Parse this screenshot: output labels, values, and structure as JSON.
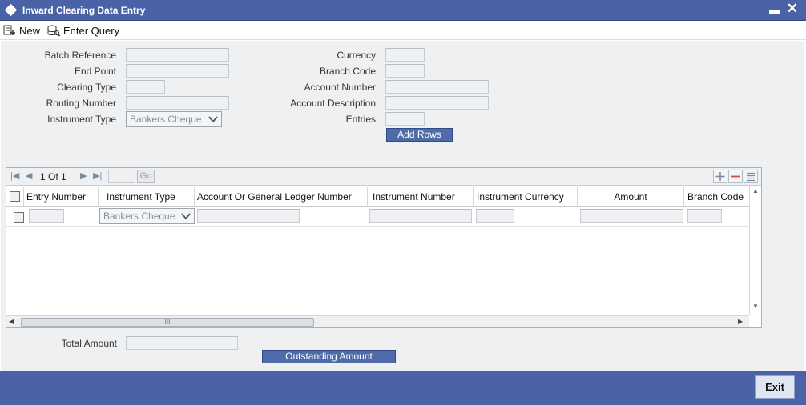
{
  "window": {
    "title": "Inward Clearing Data Entry"
  },
  "toolbar": {
    "new_label": "New",
    "enter_query_label": "Enter Query"
  },
  "form": {
    "batch_reference": {
      "label": "Batch Reference",
      "value": ""
    },
    "end_point": {
      "label": "End Point",
      "value": ""
    },
    "clearing_type": {
      "label": "Clearing Type",
      "value": ""
    },
    "routing_number": {
      "label": "Routing Number",
      "value": ""
    },
    "instrument_type": {
      "label": "Instrument Type",
      "value": "Bankers Cheque"
    },
    "currency": {
      "label": "Currency",
      "value": ""
    },
    "branch_code": {
      "label": "Branch Code",
      "value": ""
    },
    "account_number": {
      "label": "Account Number",
      "value": ""
    },
    "account_description": {
      "label": "Account Description",
      "value": ""
    },
    "entries": {
      "label": "Entries",
      "value": ""
    },
    "add_rows_label": "Add Rows"
  },
  "grid": {
    "pagination": {
      "current": "1",
      "of_label": "Of",
      "total": "1",
      "go_label": "Go"
    },
    "columns": [
      "Entry Number",
      "Instrument Type",
      "Account Or General Ledger Number",
      "Instrument Number",
      "Instrument Currency",
      "Amount",
      "Branch Code"
    ],
    "rows": [
      {
        "entry_number": "",
        "instrument_type": "Bankers Cheque",
        "account_gl_number": "",
        "instrument_number": "",
        "instrument_currency": "",
        "amount": "",
        "branch_code": ""
      }
    ],
    "scroll_label": "III"
  },
  "totals": {
    "total_amount_label": "Total Amount",
    "total_amount_value": "",
    "outstanding_amount_label": "Outstanding Amount"
  },
  "footer": {
    "exit_label": "Exit"
  },
  "colors": {
    "brand_blue": "#4a63a6",
    "form_bg": "#eef0f2"
  }
}
